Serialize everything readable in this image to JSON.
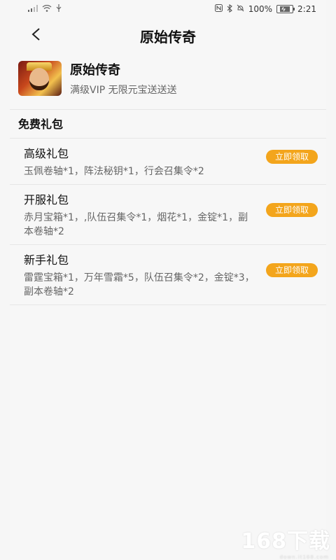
{
  "status_bar": {
    "battery_percent": "100%",
    "time": "2:21"
  },
  "header": {
    "title": "原始传奇"
  },
  "game": {
    "name": "原始传奇",
    "description": "满级VIP 无限元宝送送送"
  },
  "section": {
    "title": "免费礼包"
  },
  "packs": [
    {
      "name": "高级礼包",
      "items": "玉佩卷轴*1，阵法秘钥*1，行会召集令*2",
      "button": "立即领取"
    },
    {
      "name": "开服礼包",
      "items": "赤月宝箱*1，,队伍召集令*1，烟花*1，金锭*1，副本卷轴*2",
      "button": "立即领取"
    },
    {
      "name": "新手礼包",
      "items": "雷霆宝箱*1，万年雪霜*5，队伍召集令*2，金锭*3，副本卷轴*2",
      "button": "立即领取"
    }
  ],
  "watermark": {
    "text": "168下载",
    "sub": "down.it168.com"
  },
  "colors": {
    "accent": "#f3a51c",
    "background": "#f7f7f7"
  }
}
